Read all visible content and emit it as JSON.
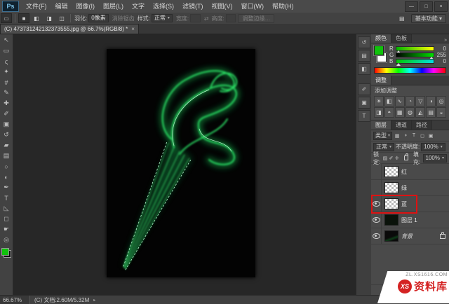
{
  "titlebar": {
    "logo": "Ps",
    "menus": [
      "文件(F)",
      "编辑",
      "图像(I)",
      "图层(L)",
      "文字",
      "选择(S)",
      "滤镜(T)",
      "视图(V)",
      "窗口(W)",
      "帮助(H)"
    ],
    "window_controls": [
      "—",
      "□",
      "×"
    ]
  },
  "optionsbar": {
    "feather_label": "羽化:",
    "feather_value": "0像素",
    "antialias_label": "消除锯齿",
    "style_label": "样式:",
    "style_value": "正常",
    "width_label": "宽度:",
    "height_label": "高度:",
    "refine_edge_label": "调整边缘…",
    "workspace_label": "基本功能"
  },
  "doc_tab": {
    "title": "(C) 473731242132373555.jpg @ 66.7%(RGB/8) *",
    "close": "×"
  },
  "tools": [
    "move",
    "rectangular-marquee",
    "lasso",
    "magic-wand",
    "crop",
    "eyedropper",
    "spot-healing",
    "brush",
    "clone-stamp",
    "history-brush",
    "eraser",
    "gradient",
    "blur",
    "dodge",
    "pen",
    "type",
    "path-selection",
    "shape",
    "hand",
    "zoom"
  ],
  "foreground_color": "#10c20c",
  "color_panel": {
    "tabs": [
      "颜色",
      "色板"
    ],
    "channels": [
      {
        "label": "R",
        "value": "0"
      },
      {
        "label": "G",
        "value": "255"
      },
      {
        "label": "B",
        "value": "0"
      }
    ]
  },
  "adjust_panel": {
    "title": "调整",
    "add_label": "添加调整",
    "icons": [
      "brightness-contrast",
      "levels",
      "curves",
      "exposure",
      "vibrance",
      "hue-saturation",
      "color-balance",
      "black-white",
      "photo-filter",
      "channel-mixer",
      "color-lookup",
      "invert",
      "posterize",
      "threshold"
    ]
  },
  "layers_panel": {
    "tabs": [
      "图层",
      "通道",
      "路径"
    ],
    "kind_label": "类型",
    "blend_mode": "正常",
    "opacity_label": "不透明度:",
    "opacity_value": "100%",
    "lock_label": "锁定:",
    "fill_label": "填充:",
    "fill_value": "100%",
    "layers": [
      {
        "name": "红",
        "visible": false,
        "highlight": false,
        "locked": false,
        "thumb": "light",
        "italic": false
      },
      {
        "name": "绿",
        "visible": false,
        "highlight": false,
        "locked": false,
        "thumb": "light",
        "italic": false
      },
      {
        "name": "蓝",
        "visible": true,
        "highlight": true,
        "locked": false,
        "thumb": "light",
        "italic": false
      },
      {
        "name": "图层 1",
        "visible": true,
        "highlight": false,
        "locked": false,
        "thumb": "dark",
        "italic": false
      },
      {
        "name": "背景",
        "visible": true,
        "highlight": false,
        "locked": true,
        "thumb": "smoke",
        "italic": true
      }
    ]
  },
  "statusbar": {
    "zoom": "66.67%",
    "doc_info": "(C) 文档:2.60M/5.32M"
  },
  "watermark": {
    "site": "ZL.XS1616.COM",
    "logo_text": "XS",
    "brand": "资料库"
  }
}
